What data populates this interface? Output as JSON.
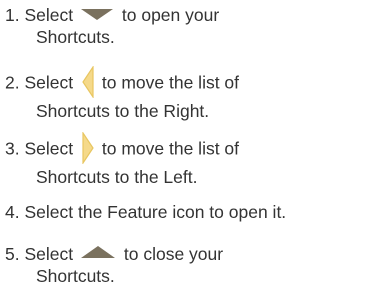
{
  "steps": [
    {
      "number": "1.",
      "before": "Select",
      "icon": "triangle-down-icon",
      "after": "to open your",
      "line2": "Shortcuts."
    },
    {
      "number": "2.",
      "before": "Select",
      "icon": "triangle-left-icon",
      "after": "to move the list of",
      "line2": "Shortcuts to the Right."
    },
    {
      "number": "3.",
      "before": "Select",
      "icon": "triangle-right-icon",
      "after": "to move the list of",
      "line2": "Shortcuts to the Left."
    },
    {
      "number": "4.",
      "text": "Select the Feature icon to open it."
    },
    {
      "number": "5.",
      "before": "Select",
      "icon": "triangle-up-icon",
      "after": "to close your",
      "line2": "Shortcuts."
    }
  ],
  "colors": {
    "text": "#333333",
    "down_up_icon": "#7a715e",
    "side_icon_fill": "#f5d98a",
    "side_icon_stroke": "#e8c660"
  }
}
